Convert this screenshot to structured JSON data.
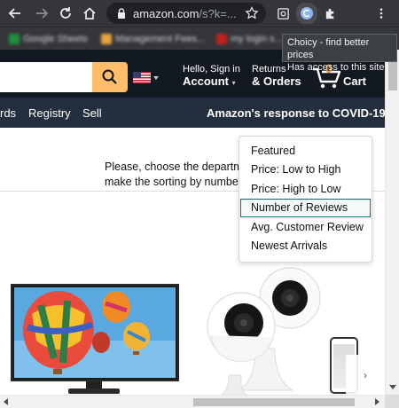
{
  "browser": {
    "url_main": "amazon.com",
    "url_rest": "/s?k=...",
    "icons": [
      "back-arrow-icon",
      "forward-arrow-icon",
      "reload-icon",
      "home-icon",
      "lock-icon",
      "star-icon",
      "ext-screenshot-icon",
      "ext-choicy-icon",
      "puzzle-icon",
      "menu-dots-icon"
    ]
  },
  "bookmarks": [
    "Google Sheets",
    "Management Fees...",
    "my login s..."
  ],
  "tooltip": {
    "line1": "Choicy - find better prices",
    "line2": "Has access to this site"
  },
  "header": {
    "account_line1": "Hello, Sign in",
    "account_line2": "Account",
    "orders_line1": "Returns",
    "orders_line2": "& Orders",
    "cart_count": "0",
    "cart_label": "Cart"
  },
  "nav": {
    "items": [
      "rds",
      "Registry",
      "Sell"
    ],
    "covid": "Amazon's response to COVID-19"
  },
  "info": {
    "line1": "Please, choose the departm",
    "line2": "make the sorting by numbe"
  },
  "sort_dropdown": {
    "options": [
      "Featured",
      "Price: Low to High",
      "Price: High to Low",
      "Number of Reviews",
      "Avg. Customer Review",
      "Newest Arrivals"
    ],
    "hovered": "Number of Reviews"
  },
  "colors": {
    "amazon_dark": "#131921",
    "amazon_nav": "#232f3e",
    "search_button": "#febd69",
    "cart_count": "#f08804",
    "chrome_bg": "#35363a",
    "dropdown_hover_border": "#007185"
  }
}
